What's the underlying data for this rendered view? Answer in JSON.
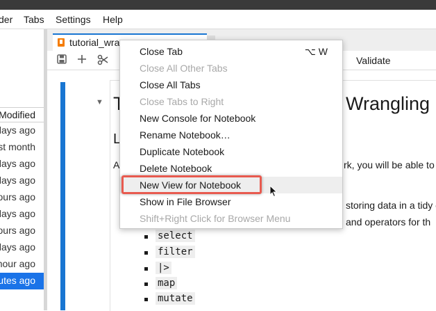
{
  "menubar": {
    "items": [
      {
        "label": "der"
      },
      {
        "label": "Tabs"
      },
      {
        "label": "Settings"
      },
      {
        "label": "Help"
      }
    ]
  },
  "file_browser": {
    "column_header": "Modified",
    "rows": [
      {
        "modified": "days ago",
        "selected": false
      },
      {
        "modified": "st month",
        "selected": false
      },
      {
        "modified": "days ago",
        "selected": false
      },
      {
        "modified": "days ago",
        "selected": false
      },
      {
        "modified": "ours ago",
        "selected": false
      },
      {
        "modified": "days ago",
        "selected": false
      },
      {
        "modified": "ours ago",
        "selected": false
      },
      {
        "modified": "days ago",
        "selected": false
      },
      {
        "modified": "hour ago",
        "selected": false
      },
      {
        "modified": "utes ago",
        "selected": true
      }
    ]
  },
  "tab": {
    "title": "tutorial_wran",
    "icon": "notebook-icon"
  },
  "toolbar": {
    "icons": [
      "save-icon",
      "add-icon",
      "cut-icon"
    ],
    "validate_label": "Validate"
  },
  "notebook": {
    "heading_first_char": "T",
    "heading_visible_tail": "Wrangling D",
    "subheading_first_char": "L",
    "para1_first_char": "A",
    "para1_tail": "rk, you will be able to",
    "para2_tail": "storing data in a tidy c",
    "para3_tail": "and operators for th",
    "code_items": [
      "select",
      "filter",
      "|>",
      "map",
      "mutate"
    ]
  },
  "context_menu": {
    "items": [
      {
        "label": "Close Tab",
        "shortcut": "⌥ W",
        "disabled": false
      },
      {
        "label": "Close All Other Tabs",
        "disabled": true
      },
      {
        "label": "Close All Tabs",
        "disabled": false
      },
      {
        "label": "Close Tabs to Right",
        "disabled": true
      },
      {
        "label": "New Console for Notebook",
        "disabled": false
      },
      {
        "label": "Rename Notebook…",
        "disabled": false
      },
      {
        "label": "Duplicate Notebook",
        "disabled": false
      },
      {
        "label": "Delete Notebook",
        "disabled": false
      },
      {
        "label": "New View for Notebook",
        "disabled": false,
        "highlighted": true
      },
      {
        "label": "Show in File Browser",
        "disabled": false
      },
      {
        "label": "Shift+Right Click for Browser Menu",
        "disabled": true
      }
    ]
  },
  "colors": {
    "accent": "#1976d2",
    "selection": "#1a73e8",
    "highlight_box": "#e85a4f"
  }
}
